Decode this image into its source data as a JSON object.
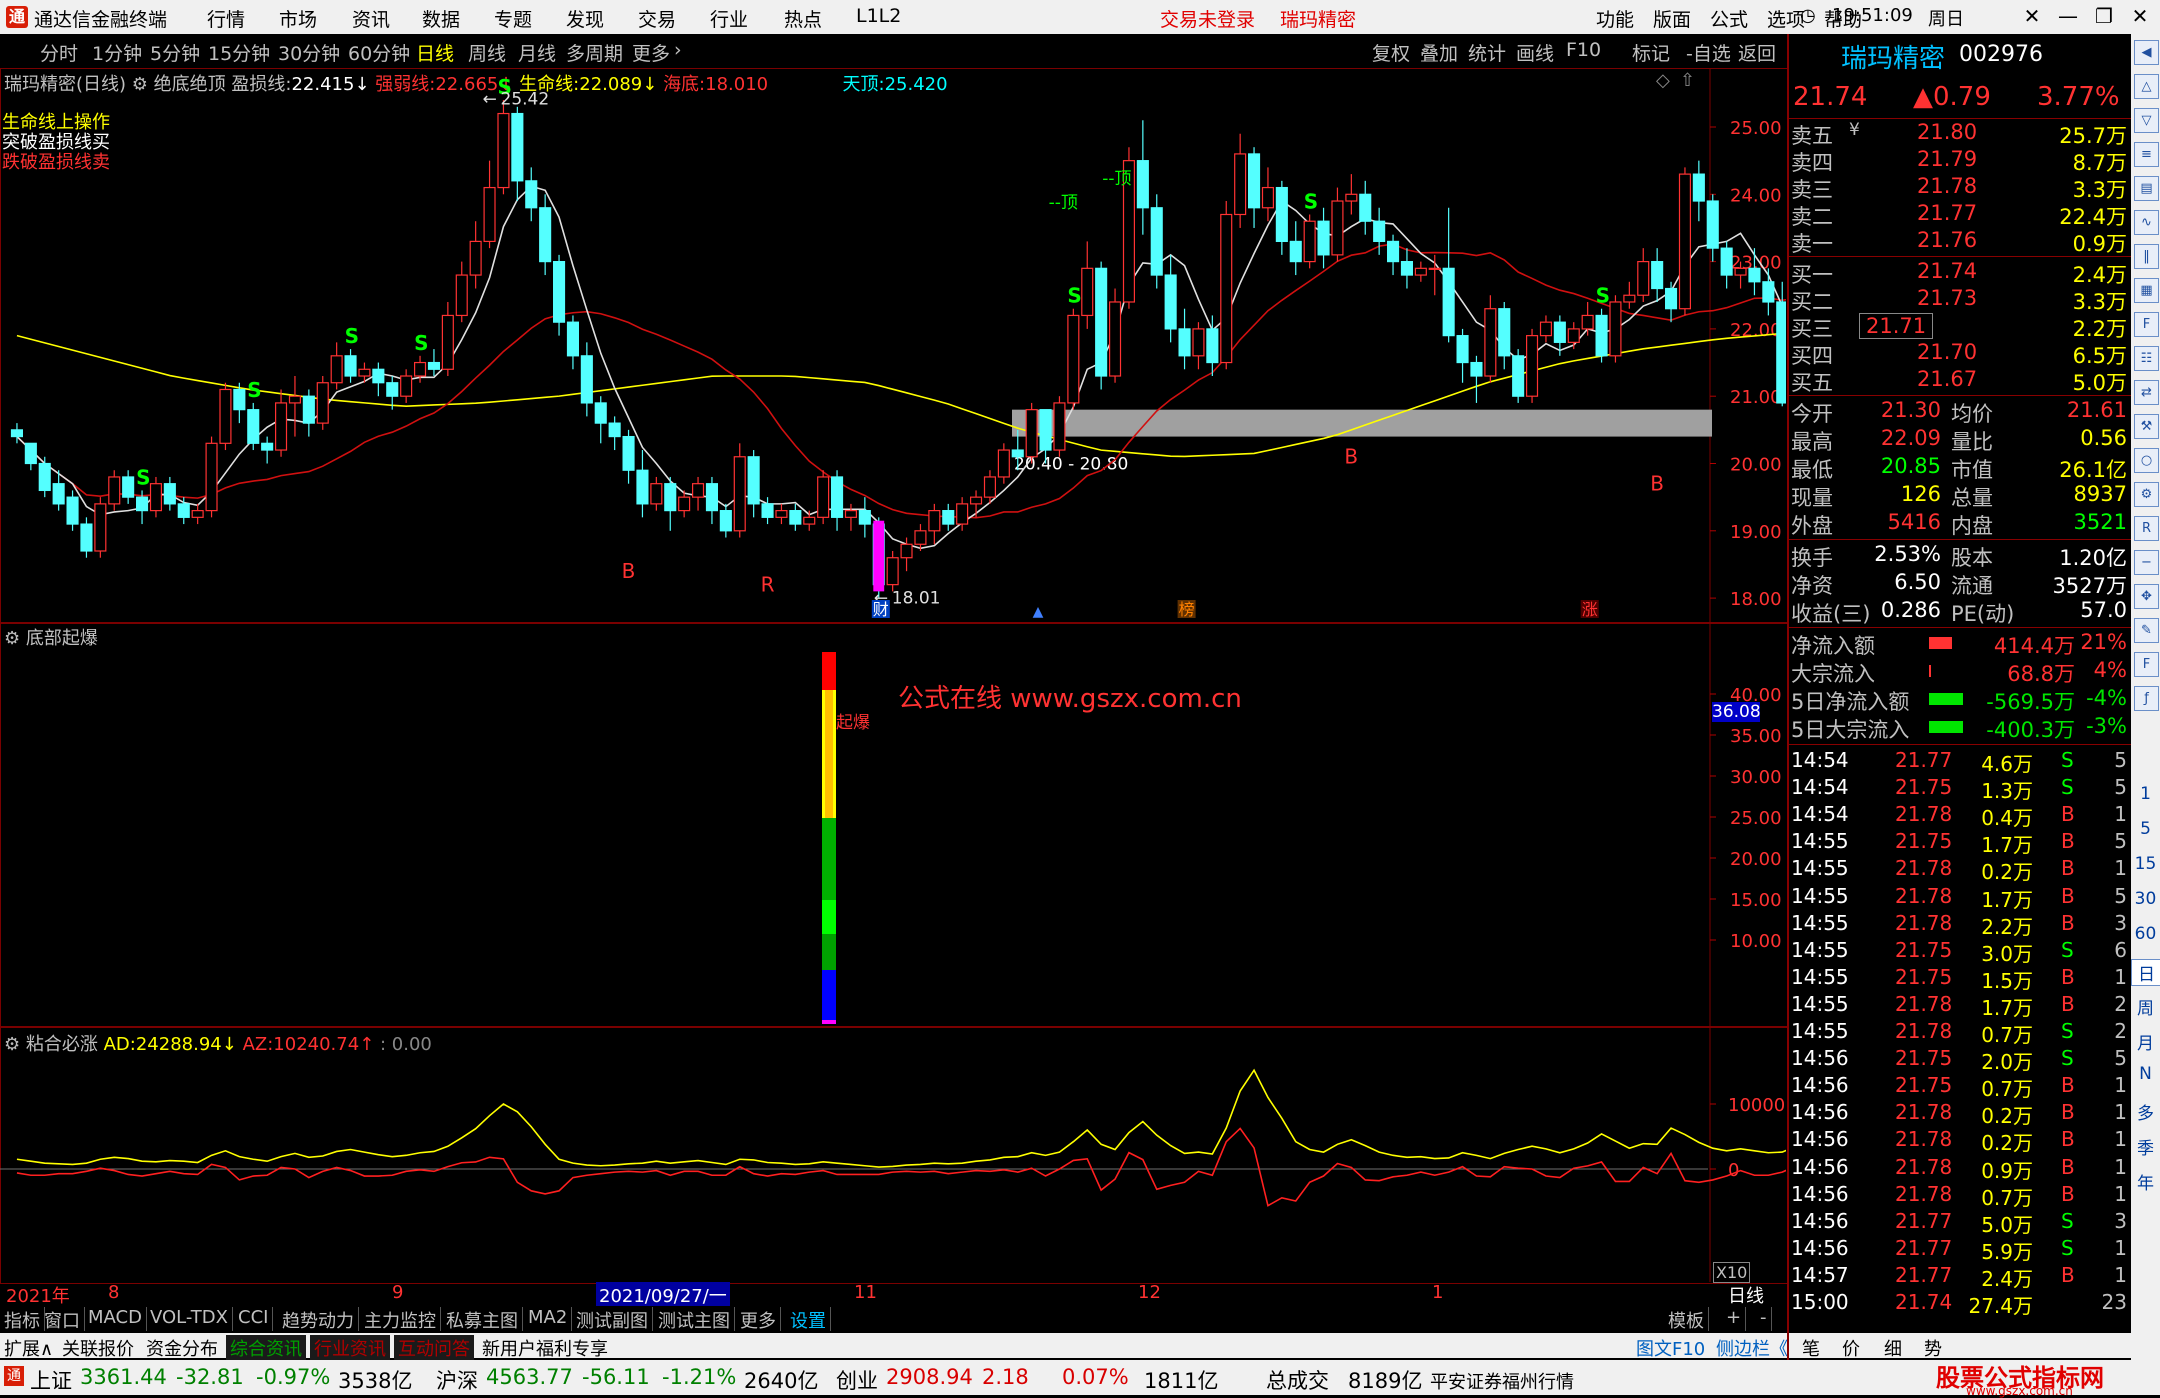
{
  "app": {
    "title": "通达信金融终端",
    "menu": [
      "行情",
      "市场",
      "资讯",
      "数据",
      "专题",
      "发现",
      "交易",
      "行业",
      "热点",
      "L1L2"
    ],
    "trade_status": "交易未登录",
    "stock_center": "瑞玛精密",
    "sys_menu": [
      "功能",
      "版面",
      "公式",
      "选项",
      "帮助"
    ],
    "time": "19:51:09",
    "weekday": "周日"
  },
  "period_tabs": [
    "分时",
    "1分钟",
    "5分钟",
    "15分钟",
    "30分钟",
    "60分钟",
    "日线",
    "周线",
    "月线",
    "多周期",
    "更多"
  ],
  "active_period": "日线",
  "right_tabs": [
    "复权",
    "叠加",
    "统计",
    "画线",
    "F10",
    "标记",
    "-自选",
    "返回"
  ],
  "main_chart": {
    "title": "瑞玛精密(日线)",
    "indicator_name": "绝底绝顶",
    "stoploss_label": "盈损线:",
    "stoploss_value": "22.415",
    "strongweak_label": "强弱线:",
    "strongweak_value": "22.665",
    "life_label": "生命线:",
    "life_value": "22.089",
    "seabottom_label": "海底:",
    "seabottom_value": "18.010",
    "skytop_label": "天顶:",
    "skytop_value": "25.420",
    "notes": [
      "生命线上操作",
      "突破盈损线买",
      "跌破盈损线卖"
    ],
    "annotations": {
      "high": "25.42",
      "low": "18.01",
      "zone": "20.40 - 20.80",
      "top_mark1": "--顶",
      "top_mark2": "--顶"
    },
    "event_tags": [
      "财",
      "榜",
      "涨"
    ],
    "yticks": [
      "25.00",
      "24.00",
      "23.00",
      "22.00",
      "21.00",
      "20.00",
      "19.00",
      "18.00"
    ]
  },
  "sub1": {
    "title": "底部起爆",
    "bar_label": "起爆",
    "watermark": "公式在线 www.gszx.com.cn",
    "current_value": "36.08",
    "yticks": [
      "40.00",
      "35.00",
      "30.00",
      "25.00",
      "20.00",
      "15.00",
      "10.00"
    ]
  },
  "sub2": {
    "title": "粘合必涨",
    "ad_label": "AD:",
    "ad_value": "24288.94",
    "az_label": "AZ:",
    "az_value": "10240.74",
    "third": ": 0.00",
    "yticks": [
      "10000",
      "0"
    ],
    "corner": "X10"
  },
  "time_axis": {
    "labels": [
      "2021年",
      "8",
      "9",
      "2021/09/27/一",
      "11",
      "12",
      "1"
    ],
    "period_label": "日线"
  },
  "bottom_tabs": [
    "指标",
    "窗口",
    "MACD",
    "VOL-TDX",
    "CCI",
    "趋势动力",
    "主力监控",
    "私募主图",
    "MA2",
    "测试副图",
    "测试主图",
    "更多",
    "设置"
  ],
  "bottom_right": [
    "模板",
    "+",
    "-"
  ],
  "bottom_tabs2": [
    "扩展∧",
    "关联报价",
    "资金分布",
    "综合资讯",
    "行业资讯",
    "互动问答",
    "新用户福利专享"
  ],
  "bottom_tabs2_right": [
    "图文F10",
    "侧边栏《",
    "笔",
    "价",
    "细",
    "势"
  ],
  "quote": {
    "name": "瑞玛精密",
    "code": "002976",
    "price": "21.74",
    "change": "▲0.79",
    "pct": "3.77%",
    "asks": [
      {
        "label": "卖五",
        "mark": "¥",
        "price": "21.80",
        "vol": "25.7万"
      },
      {
        "label": "卖四",
        "mark": "",
        "price": "21.79",
        "vol": "8.7万"
      },
      {
        "label": "卖三",
        "mark": "",
        "price": "21.78",
        "vol": "3.3万"
      },
      {
        "label": "卖二",
        "mark": "",
        "price": "21.77",
        "vol": "22.4万"
      },
      {
        "label": "卖一",
        "mark": "",
        "price": "21.76",
        "vol": "0.9万"
      }
    ],
    "bids": [
      {
        "label": "买一",
        "price": "21.74",
        "vol": "2.4万"
      },
      {
        "label": "买二",
        "price": "21.73",
        "vol": "3.3万"
      },
      {
        "label": "买三",
        "price": "21.71",
        "vol": "2.2万"
      },
      {
        "label": "买四",
        "price": "21.70",
        "vol": "6.5万"
      },
      {
        "label": "买五",
        "price": "21.67",
        "vol": "5.0万"
      }
    ],
    "stats1": [
      {
        "l1": "今开",
        "v1": "21.30",
        "l2": "均价",
        "v2": "21.61"
      },
      {
        "l1": "最高",
        "v1": "22.09",
        "l2": "量比",
        "v2": "0.56"
      },
      {
        "l1": "最低",
        "v1": "20.85",
        "l2": "市值",
        "v2": "26.1亿"
      },
      {
        "l1": "现量",
        "v1": "126",
        "l2": "总量",
        "v2": "8937"
      },
      {
        "l1": "外盘",
        "v1": "5416",
        "l2": "内盘",
        "v2": "3521"
      }
    ],
    "stats2": [
      {
        "l1": "换手",
        "v1": "2.53%",
        "l2": "股本",
        "v2": "1.20亿"
      },
      {
        "l1": "净资",
        "v1": "6.50",
        "l2": "流通",
        "v2": "3527万"
      },
      {
        "l1": "收益(三)",
        "v1": "0.286",
        "l2": "PE(动)",
        "v2": "57.0"
      }
    ],
    "flows": [
      {
        "label": "净流入额",
        "val": "414.4万",
        "pct": "21%",
        "color": "#ff3232",
        "bar": 0.6
      },
      {
        "label": "大宗流入",
        "val": "68.8万",
        "pct": "4%",
        "color": "#ff3232",
        "bar": 0.05
      },
      {
        "label": "5日净流入额",
        "val": "-569.5万",
        "pct": "-4%",
        "color": "#00e600",
        "bar": 0.9
      },
      {
        "label": "5日大宗流入",
        "val": "-400.3万",
        "pct": "-3%",
        "color": "#00e600",
        "bar": 0.9
      }
    ],
    "ticks": [
      {
        "t": "14:54",
        "p": "21.77",
        "v": "4.6万",
        "s": "S",
        "n": "5"
      },
      {
        "t": "14:54",
        "p": "21.75",
        "v": "1.3万",
        "s": "S",
        "n": "5"
      },
      {
        "t": "14:54",
        "p": "21.78",
        "v": "0.4万",
        "s": "B",
        "n": "1"
      },
      {
        "t": "14:55",
        "p": "21.75",
        "v": "1.7万",
        "s": "B",
        "n": "5"
      },
      {
        "t": "14:55",
        "p": "21.78",
        "v": "0.2万",
        "s": "B",
        "n": "1"
      },
      {
        "t": "14:55",
        "p": "21.78",
        "v": "1.7万",
        "s": "B",
        "n": "5"
      },
      {
        "t": "14:55",
        "p": "21.78",
        "v": "2.2万",
        "s": "B",
        "n": "3"
      },
      {
        "t": "14:55",
        "p": "21.75",
        "v": "3.0万",
        "s": "S",
        "n": "6"
      },
      {
        "t": "14:55",
        "p": "21.75",
        "v": "1.5万",
        "s": "B",
        "n": "1"
      },
      {
        "t": "14:55",
        "p": "21.78",
        "v": "1.7万",
        "s": "B",
        "n": "2"
      },
      {
        "t": "14:55",
        "p": "21.78",
        "v": "0.7万",
        "s": "S",
        "n": "2"
      },
      {
        "t": "14:56",
        "p": "21.75",
        "v": "2.0万",
        "s": "S",
        "n": "5"
      },
      {
        "t": "14:56",
        "p": "21.75",
        "v": "0.7万",
        "s": "B",
        "n": "1"
      },
      {
        "t": "14:56",
        "p": "21.78",
        "v": "0.2万",
        "s": "B",
        "n": "1"
      },
      {
        "t": "14:56",
        "p": "21.78",
        "v": "0.2万",
        "s": "B",
        "n": "1"
      },
      {
        "t": "14:56",
        "p": "21.78",
        "v": "0.9万",
        "s": "B",
        "n": "1"
      },
      {
        "t": "14:56",
        "p": "21.78",
        "v": "0.7万",
        "s": "B",
        "n": "1"
      },
      {
        "t": "14:56",
        "p": "21.77",
        "v": "5.0万",
        "s": "S",
        "n": "3"
      },
      {
        "t": "14:56",
        "p": "21.77",
        "v": "5.9万",
        "s": "S",
        "n": "1"
      },
      {
        "t": "14:57",
        "p": "21.77",
        "v": "2.4万",
        "s": "B",
        "n": "1"
      },
      {
        "t": "15:00",
        "p": "21.74",
        "v": "27.4万",
        "s": "",
        "n": "23"
      }
    ]
  },
  "side_tools": [
    "1",
    "5",
    "15",
    "30",
    "60",
    "日",
    "周",
    "月",
    "N",
    "多",
    "季",
    "年"
  ],
  "status_bar": [
    {
      "name": "上证",
      "val": "3361.44",
      "chg": "-32.81",
      "pct": "-0.97%",
      "amt": "3538亿"
    },
    {
      "name": "沪深",
      "val": "4563.77",
      "chg": "-56.11",
      "pct": "-1.21%",
      "amt": "2640亿"
    },
    {
      "name": "创业",
      "val": "2908.94",
      "chg": "2.18",
      "pct": "0.07%",
      "amt": "1811亿"
    }
  ],
  "total_label": "总成交",
  "total_value": "8189亿",
  "broker": "平安证券福州行情",
  "watermark_site": "股票公式指标网",
  "watermark_url": "www.gszx.com.cn",
  "chart_data": {
    "type": "candlestick",
    "ylim": [
      17.8,
      25.4
    ],
    "candles": [
      [
        20.5,
        20.6,
        20.4,
        20.3
      ],
      [
        20.3,
        20.3,
        20.0,
        19.9
      ],
      [
        20.0,
        20.1,
        19.6,
        19.5
      ],
      [
        19.7,
        19.9,
        19.4,
        19.3
      ],
      [
        19.5,
        19.6,
        19.1,
        19.0
      ],
      [
        19.1,
        19.2,
        18.7,
        18.6
      ],
      [
        18.7,
        19.5,
        19.4,
        18.6
      ],
      [
        19.4,
        19.9,
        19.8,
        19.3
      ],
      [
        19.8,
        19.9,
        19.5,
        19.4
      ],
      [
        19.5,
        19.6,
        19.3,
        19.1
      ],
      [
        19.3,
        19.8,
        19.7,
        19.2
      ],
      [
        19.7,
        19.8,
        19.4,
        19.3
      ],
      [
        19.4,
        19.5,
        19.2,
        19.1
      ],
      [
        19.2,
        19.4,
        19.3,
        19.1
      ],
      [
        19.3,
        20.4,
        20.3,
        19.2
      ],
      [
        20.3,
        21.2,
        21.1,
        20.2
      ],
      [
        21.1,
        21.2,
        20.8,
        20.6
      ],
      [
        20.8,
        20.9,
        20.3,
        20.2
      ],
      [
        20.3,
        20.4,
        20.2,
        20.0
      ],
      [
        20.2,
        21.1,
        20.9,
        20.1
      ],
      [
        20.9,
        21.3,
        21.0,
        20.4
      ],
      [
        21.0,
        21.1,
        20.6,
        20.4
      ],
      [
        20.6,
        21.3,
        21.2,
        20.5
      ],
      [
        21.2,
        21.8,
        21.6,
        21.1
      ],
      [
        21.6,
        21.7,
        21.3,
        21.2
      ],
      [
        21.3,
        21.5,
        21.4,
        21.2
      ],
      [
        21.4,
        21.5,
        21.2,
        21.0
      ],
      [
        21.2,
        21.3,
        21.0,
        20.8
      ],
      [
        21.0,
        21.4,
        21.3,
        20.9
      ],
      [
        21.3,
        21.6,
        21.5,
        21.2
      ],
      [
        21.5,
        21.7,
        21.4,
        21.3
      ],
      [
        21.4,
        22.4,
        22.2,
        21.3
      ],
      [
        22.2,
        23.0,
        22.8,
        22.1
      ],
      [
        22.8,
        23.6,
        23.3,
        22.6
      ],
      [
        23.3,
        24.5,
        24.1,
        23.2
      ],
      [
        24.1,
        25.4,
        25.2,
        24.0
      ],
      [
        25.2,
        25.3,
        24.2,
        23.9
      ],
      [
        24.2,
        24.4,
        23.8,
        23.6
      ],
      [
        23.8,
        24.0,
        23.0,
        22.8
      ],
      [
        23.0,
        23.1,
        22.1,
        21.9
      ],
      [
        22.1,
        22.2,
        21.6,
        21.4
      ],
      [
        21.6,
        21.8,
        20.9,
        20.7
      ],
      [
        20.9,
        21.0,
        20.6,
        20.3
      ],
      [
        20.6,
        20.7,
        20.4,
        20.2
      ],
      [
        20.4,
        20.5,
        19.9,
        19.7
      ],
      [
        19.9,
        20.2,
        19.4,
        19.2
      ],
      [
        19.4,
        19.8,
        19.7,
        19.3
      ],
      [
        19.7,
        19.8,
        19.3,
        19.0
      ],
      [
        19.3,
        19.6,
        19.5,
        19.2
      ],
      [
        19.5,
        19.8,
        19.7,
        19.3
      ],
      [
        19.7,
        19.8,
        19.3,
        19.1
      ],
      [
        19.3,
        19.4,
        19.0,
        18.9
      ],
      [
        19.0,
        20.3,
        20.1,
        18.9
      ],
      [
        20.1,
        20.2,
        19.4,
        19.2
      ],
      [
        19.4,
        19.5,
        19.2,
        19.1
      ],
      [
        19.2,
        19.4,
        19.3,
        19.1
      ],
      [
        19.3,
        19.4,
        19.1,
        19.0
      ],
      [
        19.1,
        19.3,
        19.2,
        19.0
      ],
      [
        19.2,
        19.9,
        19.8,
        19.1
      ],
      [
        19.8,
        19.9,
        19.2,
        19.0
      ],
      [
        19.2,
        19.4,
        19.3,
        19.0
      ],
      [
        19.3,
        19.5,
        19.1,
        18.9
      ],
      [
        19.1,
        19.2,
        18.2,
        18.01
      ],
      [
        18.2,
        18.7,
        18.6,
        18.1
      ],
      [
        18.6,
        18.9,
        18.8,
        18.4
      ],
      [
        18.8,
        19.1,
        19.0,
        18.7
      ],
      [
        19.0,
        19.4,
        19.3,
        18.8
      ],
      [
        19.3,
        19.4,
        19.1,
        19.0
      ],
      [
        19.1,
        19.5,
        19.4,
        19.0
      ],
      [
        19.4,
        19.6,
        19.5,
        19.2
      ],
      [
        19.5,
        19.9,
        19.8,
        19.4
      ],
      [
        19.8,
        20.3,
        20.2,
        19.7
      ],
      [
        20.2,
        20.5,
        20.1,
        19.9
      ],
      [
        20.1,
        20.9,
        20.8,
        20.0
      ],
      [
        20.8,
        20.8,
        20.2,
        20.0
      ],
      [
        20.2,
        21.0,
        20.9,
        20.1
      ],
      [
        20.9,
        22.3,
        22.2,
        20.8
      ],
      [
        22.2,
        23.3,
        22.9,
        22.0
      ],
      [
        22.9,
        23.0,
        21.3,
        21.1
      ],
      [
        21.3,
        22.6,
        22.4,
        21.2
      ],
      [
        22.4,
        24.7,
        24.5,
        22.3
      ],
      [
        24.5,
        25.1,
        23.8,
        23.4
      ],
      [
        23.8,
        24.0,
        22.8,
        22.6
      ],
      [
        22.8,
        23.1,
        22.0,
        21.8
      ],
      [
        22.0,
        22.3,
        21.6,
        21.4
      ],
      [
        21.6,
        22.1,
        22.0,
        21.4
      ],
      [
        22.0,
        22.2,
        21.5,
        21.3
      ],
      [
        21.5,
        23.9,
        23.7,
        21.4
      ],
      [
        23.7,
        24.9,
        24.6,
        23.5
      ],
      [
        24.6,
        24.7,
        23.8,
        23.5
      ],
      [
        23.8,
        24.4,
        24.1,
        23.6
      ],
      [
        24.1,
        24.2,
        23.3,
        23.1
      ],
      [
        23.3,
        23.6,
        23.0,
        22.8
      ],
      [
        23.0,
        23.7,
        23.6,
        22.9
      ],
      [
        23.6,
        23.8,
        23.1,
        22.9
      ],
      [
        23.1,
        24.1,
        23.9,
        23.0
      ],
      [
        23.9,
        24.3,
        24.0,
        23.7
      ],
      [
        24.0,
        24.2,
        23.6,
        23.4
      ],
      [
        23.6,
        23.8,
        23.3,
        23.1
      ],
      [
        23.3,
        23.4,
        23.0,
        22.8
      ],
      [
        23.0,
        23.2,
        22.8,
        22.6
      ],
      [
        22.8,
        23.0,
        22.9,
        22.7
      ],
      [
        22.9,
        23.1,
        22.9,
        22.5
      ],
      [
        22.9,
        23.8,
        21.9,
        21.8
      ],
      [
        21.9,
        22.0,
        21.5,
        21.2
      ],
      [
        21.5,
        21.6,
        21.3,
        20.9
      ],
      [
        21.3,
        22.5,
        22.3,
        21.2
      ],
      [
        22.3,
        22.4,
        21.6,
        21.4
      ],
      [
        21.6,
        21.7,
        21.0,
        20.9
      ],
      [
        21.0,
        22.0,
        21.9,
        20.9
      ],
      [
        21.9,
        22.2,
        22.1,
        21.8
      ],
      [
        22.1,
        22.2,
        21.8,
        21.6
      ],
      [
        21.8,
        22.1,
        22.0,
        21.7
      ],
      [
        22.0,
        22.4,
        22.2,
        21.9
      ],
      [
        22.2,
        22.3,
        21.6,
        21.5
      ],
      [
        21.6,
        22.5,
        22.4,
        21.5
      ],
      [
        22.4,
        22.7,
        22.5,
        22.3
      ],
      [
        22.5,
        23.2,
        23.0,
        22.4
      ],
      [
        23.0,
        23.2,
        22.6,
        22.4
      ],
      [
        22.6,
        22.7,
        22.3,
        22.1
      ],
      [
        22.3,
        24.4,
        24.3,
        22.2
      ],
      [
        24.3,
        24.5,
        23.9,
        23.6
      ],
      [
        23.9,
        24.0,
        23.2,
        23.0
      ],
      [
        23.2,
        23.3,
        22.8,
        22.6
      ],
      [
        22.8,
        23.0,
        22.9,
        22.6
      ],
      [
        22.9,
        23.2,
        22.7,
        22.5
      ],
      [
        22.7,
        22.9,
        22.4,
        22.2
      ],
      [
        22.4,
        22.7,
        20.9,
        20.85
      ],
      [
        20.95,
        22.09,
        21.74,
        20.85
      ]
    ],
    "signals": [
      {
        "i": 9,
        "type": "S"
      },
      {
        "i": 17,
        "type": "S"
      },
      {
        "i": 24,
        "type": "S"
      },
      {
        "i": 35,
        "type": "S"
      },
      {
        "i": 29,
        "type": "S"
      },
      {
        "i": 93,
        "type": "S"
      },
      {
        "i": 114,
        "type": "S"
      },
      {
        "i": 76,
        "type": "S"
      }
    ],
    "b_marks": [
      {
        "i": 44,
        "price": 18.3,
        "t": "B"
      },
      {
        "i": 54,
        "price": 18.1,
        "t": "R"
      },
      {
        "i": 96,
        "price": 20.0,
        "t": "B"
      },
      {
        "i": 118,
        "price": 19.6,
        "t": "B"
      }
    ],
    "ad": [
      1500,
      1200,
      900,
      800,
      700,
      900,
      1500,
      1800,
      1600,
      1200,
      1100,
      1300,
      1200,
      1000,
      2100,
      2800,
      1900,
      1500,
      1200,
      1900,
      2400,
      1800,
      2000,
      2700,
      3000,
      2600,
      2200,
      1900,
      2100,
      2500,
      2700,
      3500,
      4800,
      6200,
      8200,
      10000,
      8800,
      6500,
      3800,
      1500,
      900,
      600,
      500,
      600,
      800,
      900,
      1200,
      900,
      1100,
      1300,
      1000,
      700,
      1500,
      1400,
      1000,
      900,
      700,
      800,
      1100,
      900,
      700,
      500,
      300,
      400,
      600,
      700,
      900,
      800,
      900,
      1200,
      1400,
      1800,
      1900,
      2500,
      2100,
      2600,
      4200,
      6000,
      3800,
      3000,
      5600,
      7300,
      5200,
      3600,
      2400,
      2600,
      2300,
      6300,
      12000,
      15200,
      11000,
      7800,
      4200,
      3000,
      2600,
      3800,
      4500,
      3600,
      2600,
      2100,
      1800,
      1900,
      1600,
      1700,
      2500,
      2100,
      1600,
      2400,
      3000,
      3500,
      3100,
      2500,
      3100,
      4000,
      5400,
      4300,
      3200,
      3900,
      3800,
      6300,
      5300,
      4100,
      3200,
      2800,
      3100,
      2800,
      2500,
      2600,
      3500
    ]
  }
}
